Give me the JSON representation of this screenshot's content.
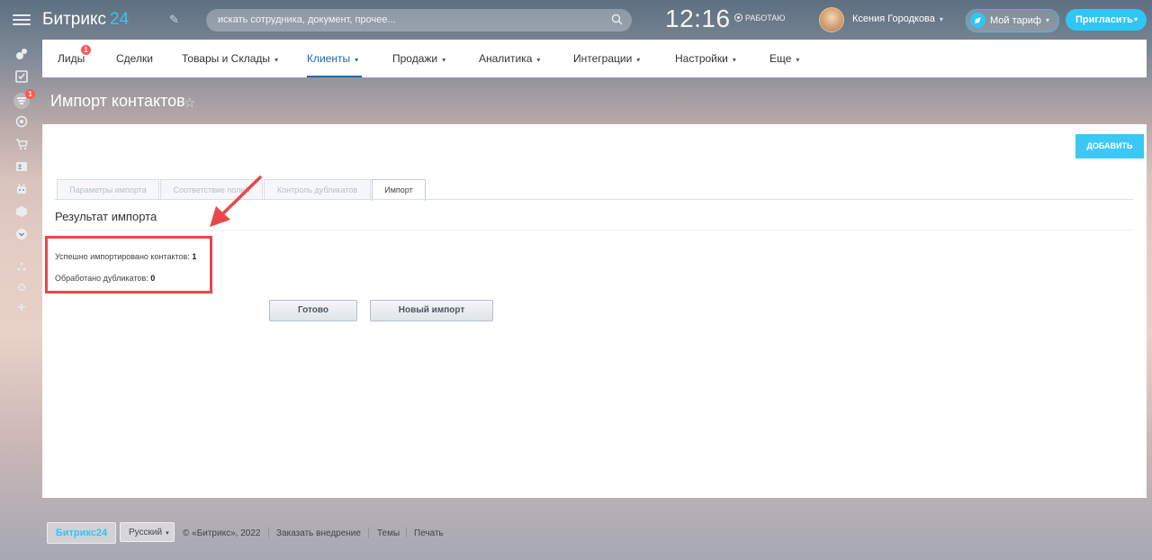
{
  "header": {
    "logo_name": "Битрикс",
    "logo_num": "24",
    "search_placeholder": "искать сотрудника, документ, прочее...",
    "clock": "12:16",
    "work_status": "РАБОТАЮ",
    "user_name": "Ксения Городкова",
    "tariff_label": "Мой тариф",
    "invite_label": "Пригласить"
  },
  "left_nav": {
    "badge": "1"
  },
  "crm_nav": {
    "items": [
      {
        "label": "Лиды",
        "badge": "1"
      },
      {
        "label": "Сделки"
      },
      {
        "label": "Товары и Склады"
      },
      {
        "label": "Клиенты"
      },
      {
        "label": "Продажи"
      },
      {
        "label": "Аналитика"
      },
      {
        "label": "Интеграции"
      },
      {
        "label": "Настройки"
      },
      {
        "label": "Еще"
      }
    ],
    "active": "Клиенты"
  },
  "page": {
    "title": "Импорт контактов",
    "add_button": "ДОБАВИТЬ",
    "tabs": [
      "Параметры импорта",
      "Соответствие полей",
      "Контроль дубликатов",
      "Импорт"
    ],
    "active_tab": "Импорт",
    "section_title": "Результат импорта",
    "stats": [
      {
        "label": "Успешно импортировано контактов:",
        "value": "1"
      },
      {
        "label": "Обработано дубликатов:",
        "value": "0"
      }
    ],
    "done_button": "Готово",
    "new_import_button": "Новый импорт"
  },
  "footer": {
    "logo": "Битрикс24",
    "language": "Русский",
    "copyright": "© «Битрикс», 2022",
    "links": [
      "Заказать внедрение",
      "Темы",
      "Печать"
    ]
  },
  "colors": {
    "accent": "#2fc6f6",
    "active_nav": "#2067b0",
    "highlight": "#e8474a",
    "badge": "#ff5752"
  }
}
